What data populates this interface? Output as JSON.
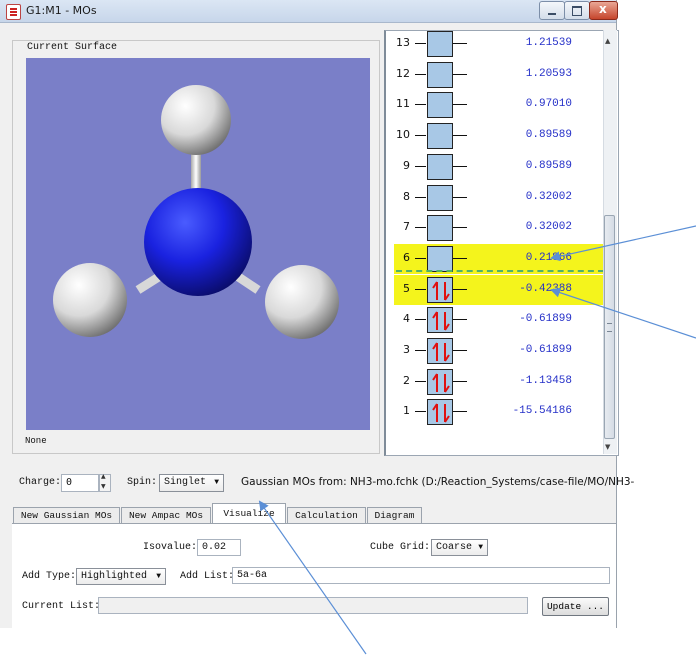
{
  "window": {
    "title": "G1:M1 - MOs",
    "close_glyph": "x",
    "icon": "app-icon"
  },
  "surface": {
    "group_label": "Current Surface",
    "status_label": "None",
    "background_color": "#7a7fc8"
  },
  "mo_list": {
    "highlight_color": "#f4f41c",
    "occupied_rows": [
      5,
      4,
      3,
      2,
      1
    ],
    "rows": [
      {
        "num": "13",
        "value": "1.21539"
      },
      {
        "num": "12",
        "value": "1.20593"
      },
      {
        "num": "11",
        "value": "0.97010"
      },
      {
        "num": "10",
        "value": "0.89589"
      },
      {
        "num": "9",
        "value": "0.89589"
      },
      {
        "num": "8",
        "value": "0.32002"
      },
      {
        "num": "7",
        "value": "0.32002"
      },
      {
        "num": "6",
        "value": "0.21866"
      },
      {
        "num": "5",
        "value": "-0.42388"
      },
      {
        "num": "4",
        "value": "-0.61899"
      },
      {
        "num": "3",
        "value": "-0.61899"
      },
      {
        "num": "2",
        "value": "-1.13458"
      },
      {
        "num": "1",
        "value": "-15.54186"
      }
    ]
  },
  "controls": {
    "charge_label": "Charge:",
    "charge_value": "0",
    "spin_label": "Spin:",
    "spin_value": "Singlet",
    "gaussian_mos_from": "Gaussian MOs from:  NH3-mo.fchk (D:/Reaction_Systems/case-file/MO/NH3-"
  },
  "tabs": [
    {
      "label": "New Gaussian MOs"
    },
    {
      "label": "New Ampac MOs"
    },
    {
      "label": "Visualize"
    },
    {
      "label": "Calculation"
    },
    {
      "label": "Diagram"
    }
  ],
  "visualize": {
    "isovalue_label": "Isovalue:",
    "isovalue": "0.02",
    "cube_grid_label": "Cube Grid:",
    "cube_grid": "Coarse",
    "add_type_label": "Add Type:",
    "add_type": "Highlighted",
    "add_list_label": "Add List:",
    "add_list": "5a-6a",
    "current_list_label": "Current List:",
    "current_list": "",
    "update_button": "Update ..."
  },
  "annotation_color": "#5b8fd6"
}
